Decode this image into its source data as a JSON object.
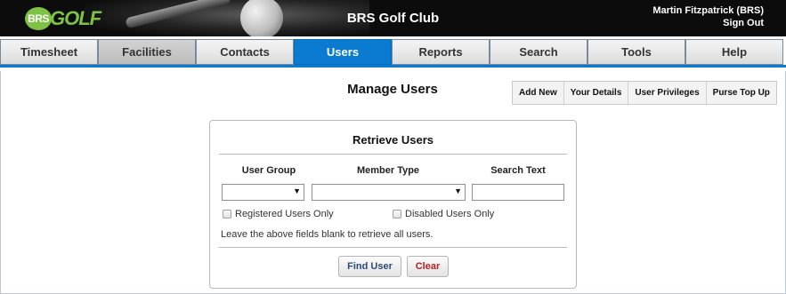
{
  "header": {
    "logo_brs": "BRS",
    "logo_golf": "GOLF",
    "club_name": "BRS Golf Club",
    "user_name": "Martin Fitzpatrick (BRS)",
    "sign_out": "Sign Out"
  },
  "nav": {
    "active": "Users",
    "tabs": [
      "Timesheet",
      "Facilities",
      "Contacts",
      "Users",
      "Reports",
      "Search",
      "Tools",
      "Help"
    ]
  },
  "page": {
    "title": "Manage Users",
    "toolbar": [
      "Add New",
      "Your Details",
      "User Privileges",
      "Purse Top Up"
    ]
  },
  "retrieve": {
    "title": "Retrieve Users",
    "user_group_label": "User Group",
    "member_type_label": "Member Type",
    "search_text_label": "Search Text",
    "user_group_value": "",
    "member_type_value": "",
    "search_text_value": "",
    "registered_only_label": "Registered Users Only",
    "disabled_only_label": "Disabled Users Only",
    "hint": "Leave the above fields blank to retrieve all users.",
    "find_button": "Find User",
    "clear_button": "Clear"
  },
  "colors": {
    "accent": "#0a7bd0",
    "brand_green": "#7dc242",
    "header_bg": "#0c0c0c"
  }
}
